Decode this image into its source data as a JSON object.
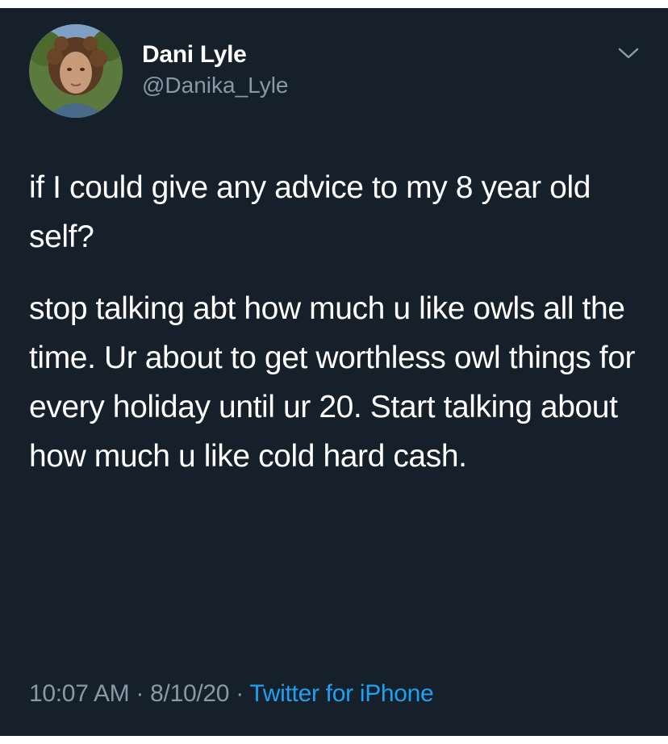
{
  "author": {
    "display_name": "Dani Lyle",
    "handle": "@Danika_Lyle"
  },
  "tweet": {
    "paragraphs": [
      "if I could give any advice to my 8 year old self?",
      "stop talking abt how much u like owls all the time. Ur about to get worthless owl things for every holiday until ur 20. Start talking about how much u like cold hard cash."
    ]
  },
  "meta": {
    "time": "10:07 AM",
    "separator": "·",
    "date": "8/10/20",
    "source": "Twitter for iPhone"
  },
  "icons": {
    "menu": "chevron-down-icon"
  },
  "colors": {
    "background": "#15202b",
    "text": "#ffffff",
    "secondary_text": "#8899a6",
    "link": "#1da1f2"
  }
}
